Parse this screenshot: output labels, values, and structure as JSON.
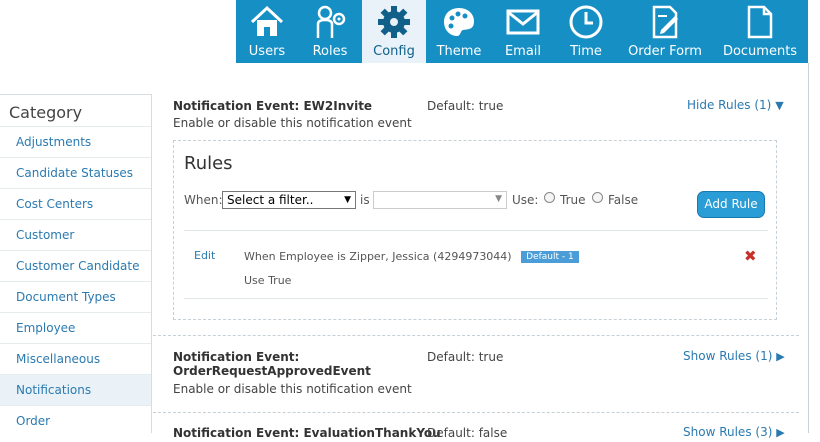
{
  "nav": {
    "items": [
      {
        "label": "Users",
        "icon": "house-icon"
      },
      {
        "label": "Roles",
        "icon": "user-gear-icon"
      },
      {
        "label": "Config",
        "icon": "gear-icon"
      },
      {
        "label": "Theme",
        "icon": "palette-icon"
      },
      {
        "label": "Email",
        "icon": "envelope-icon"
      },
      {
        "label": "Time",
        "icon": "clock-icon"
      },
      {
        "label": "Order Form",
        "icon": "document-edit-icon"
      },
      {
        "label": "Documents",
        "icon": "document-icon"
      }
    ],
    "active": "Config",
    "colors": {
      "bar": "#168fc4",
      "active_bg": "#e8f2f8"
    }
  },
  "sidebar": {
    "title": "Category",
    "items": [
      {
        "label": "Adjustments"
      },
      {
        "label": "Candidate Statuses"
      },
      {
        "label": "Cost Centers"
      },
      {
        "label": "Customer"
      },
      {
        "label": "Customer Candidate"
      },
      {
        "label": "Document Types"
      },
      {
        "label": "Employee"
      },
      {
        "label": "Miscellaneous"
      },
      {
        "label": "Notifications"
      },
      {
        "label": "Order"
      }
    ],
    "active": "Notifications"
  },
  "events": [
    {
      "title": "Notification Event: EW2Invite",
      "description": "Enable or disable this notification event",
      "default": "Default: true",
      "toggle": "Hide Rules (1)",
      "toggle_icon": "triangle-down-icon",
      "rules": {
        "heading": "Rules",
        "when_label": "When:",
        "filter_value": "Select a filter..",
        "is_label": "is",
        "use_label": "Use:",
        "true_label": "True",
        "false_label": "False",
        "add_button": "Add Rule",
        "rule": {
          "edit": "Edit",
          "when_prefix": "When",
          "field": "Employee",
          "op": "is",
          "value": "Zipper, Jessica (4294973044)",
          "badge": "Default - 1",
          "use_prefix": "Use",
          "use_value": "True"
        }
      }
    },
    {
      "title_line1": "Notification Event:",
      "title_line2": "OrderRequestApprovedEvent",
      "description": "Enable or disable this notification event",
      "default": "Default: true",
      "toggle": "Show Rules (1)",
      "toggle_icon": "triangle-right-icon"
    },
    {
      "title": "Notification Event: EvaluationThankYou",
      "default": "Default: false",
      "toggle": "Show Rules (3)",
      "toggle_icon": "triangle-right-icon"
    }
  ]
}
